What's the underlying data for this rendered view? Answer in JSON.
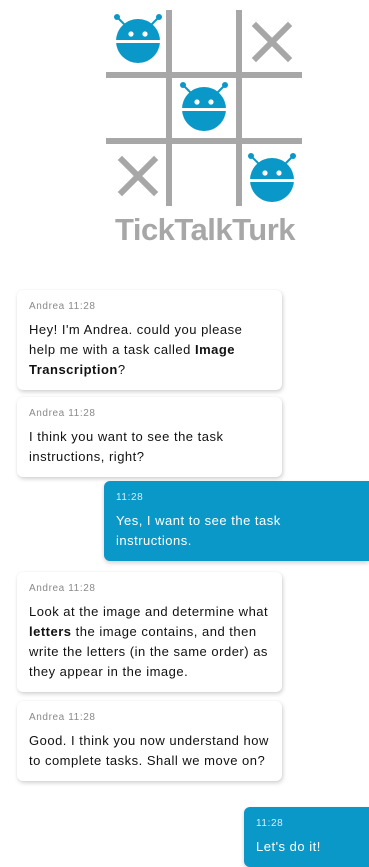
{
  "logo": {
    "text": "TickTalkTurk",
    "colors": {
      "grid": "#a7a7a7",
      "robot": "#0a98c8",
      "x_mark": "#a7a7a7"
    }
  },
  "messages": [
    {
      "direction": "incoming",
      "sender": "Andrea",
      "time": "11:28",
      "parts": [
        {
          "text": "Hey! I'm Andrea. could you please help me with a task called "
        },
        {
          "text": "Image Transcription",
          "bold": true
        },
        {
          "text": "?"
        }
      ]
    },
    {
      "direction": "incoming",
      "sender": "Andrea",
      "time": "11:28",
      "parts": [
        {
          "text": "I think you want to see the task instructions, right?"
        }
      ]
    },
    {
      "direction": "outgoing",
      "time": "11:28",
      "parts": [
        {
          "text": "Yes, I want to see the task instructions."
        }
      ]
    },
    {
      "direction": "incoming",
      "sender": "Andrea",
      "time": "11:28",
      "parts": [
        {
          "text": "Look at the image and determine what "
        },
        {
          "text": "letters",
          "bold": true
        },
        {
          "text": " the image contains, and then write the letters (in the same order) as they appear in the image."
        }
      ]
    },
    {
      "direction": "incoming",
      "sender": "Andrea",
      "time": "11:28",
      "parts": [
        {
          "text": "Good. I think you now understand how to complete tasks. Shall we move on?"
        }
      ]
    },
    {
      "direction": "outgoing",
      "time": "11:28",
      "parts": [
        {
          "text": "Let's do it!"
        }
      ]
    }
  ],
  "colors": {
    "outgoing_bubble": "#0a98c8",
    "incoming_bubble": "#ffffff",
    "meta_text": "#8a8a8a"
  }
}
